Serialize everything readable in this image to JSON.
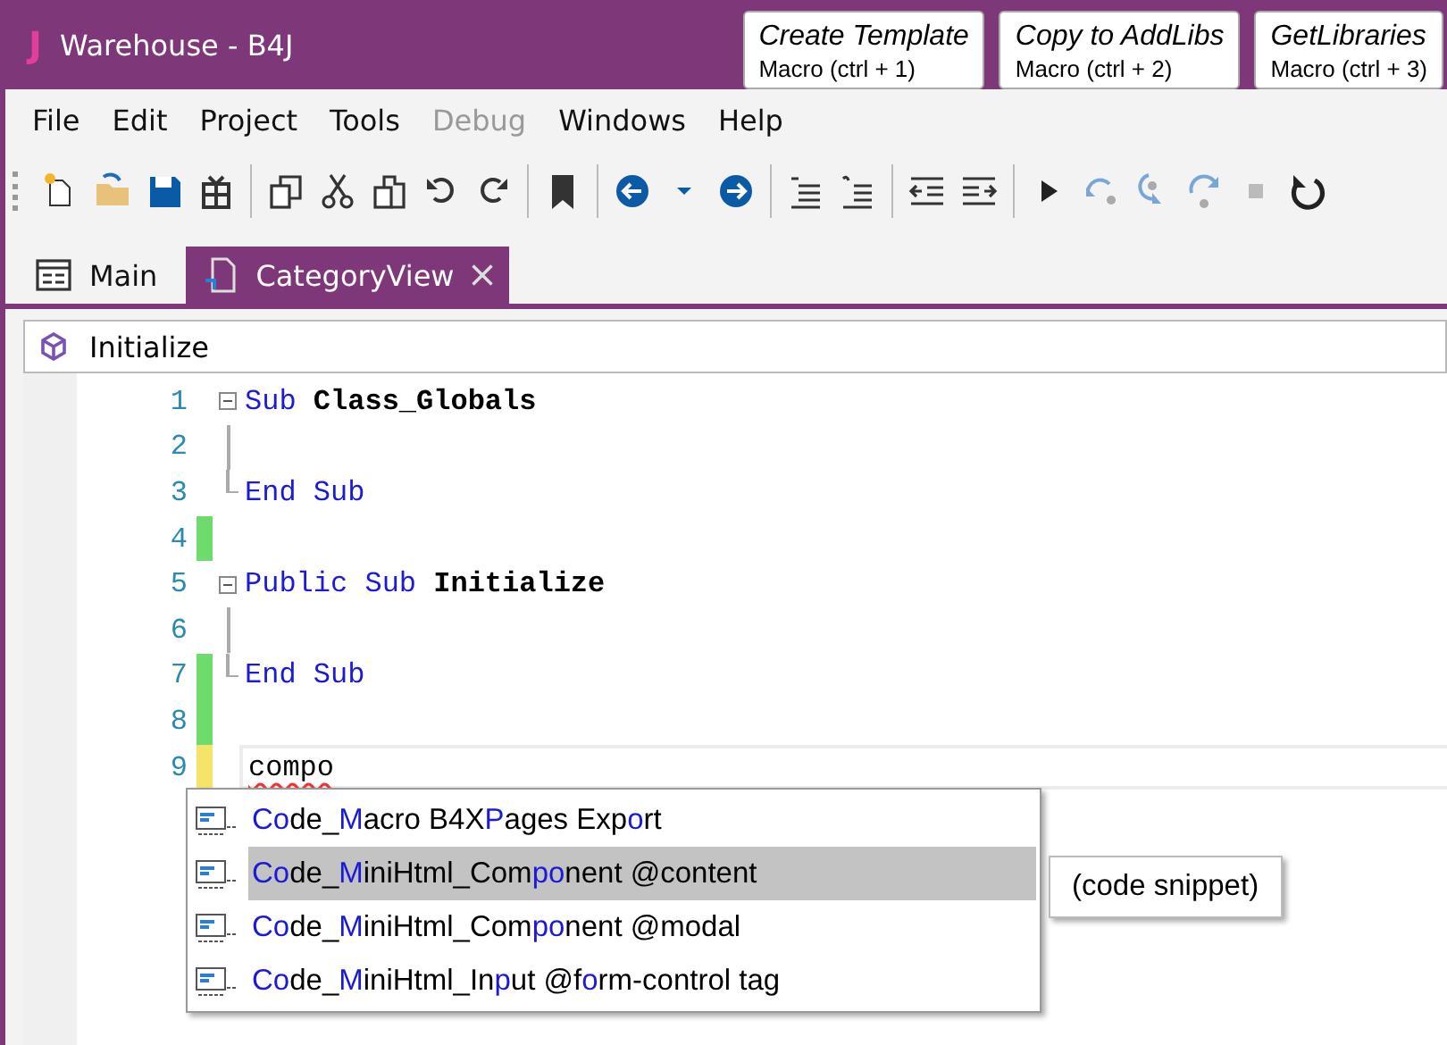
{
  "window": {
    "logo": "J",
    "title": "Warehouse - B4J"
  },
  "macros": [
    {
      "title": "Create Template",
      "subtitle": "Macro  (ctrl + 1)"
    },
    {
      "title": "Copy to AddLibs",
      "subtitle": "Macro  (ctrl + 2)"
    },
    {
      "title": "GetLibraries",
      "subtitle": "Macro  (ctrl + 3)"
    }
  ],
  "menu": [
    {
      "label": "File",
      "disabled": false
    },
    {
      "label": "Edit",
      "disabled": false
    },
    {
      "label": "Project",
      "disabled": false
    },
    {
      "label": "Tools",
      "disabled": false
    },
    {
      "label": "Debug",
      "disabled": true
    },
    {
      "label": "Windows",
      "disabled": false
    },
    {
      "label": "Help",
      "disabled": false
    }
  ],
  "tabs": [
    {
      "label": "Main",
      "selected": false,
      "closable": false
    },
    {
      "label": "CategoryView",
      "selected": true,
      "closable": true
    }
  ],
  "member_bar": {
    "label": "Initialize"
  },
  "editor": {
    "lines": [
      {
        "number": "1",
        "collapsible": true,
        "in_block": false,
        "current": false,
        "tokens": [
          {
            "kind": "keyword",
            "text": "Sub"
          },
          {
            "kind": "name",
            "text": "Class_Globals"
          }
        ]
      },
      {
        "number": "2",
        "collapsible": false,
        "in_block": true,
        "current": false
      },
      {
        "number": "3",
        "collapsible": false,
        "in_block": true,
        "current": false,
        "tokens": [
          {
            "kind": "keyword",
            "text": "End Sub"
          }
        ]
      },
      {
        "number": "4",
        "collapsible": false,
        "in_block": false,
        "current": false,
        "color": "#6ddc6d"
      },
      {
        "number": "5",
        "collapsible": true,
        "in_block": false,
        "current": false,
        "tokens": [
          {
            "kind": "keyword",
            "text": "Public Sub"
          },
          {
            "kind": "name",
            "text": "Initialize"
          }
        ]
      },
      {
        "number": "6",
        "collapsible": false,
        "in_block": true,
        "current": false
      },
      {
        "number": "7",
        "collapsible": false,
        "in_block": true,
        "current": false,
        "color": "#6ddc6d",
        "tokens": [
          {
            "kind": "keyword",
            "text": "End Sub"
          }
        ]
      },
      {
        "number": "8",
        "collapsible": false,
        "in_block": false,
        "current": false,
        "color": "#6ddc6d"
      },
      {
        "number": "9",
        "collapsible": false,
        "in_block": false,
        "current": true,
        "color": "#f5e36a",
        "tokens": [
          {
            "kind": "error",
            "text": "compo"
          }
        ]
      }
    ]
  },
  "autocomplete": {
    "items": [
      {
        "selected": false,
        "parts": [
          {
            "text": "Co",
            "match": true
          },
          {
            "text": "de_",
            "match": false
          },
          {
            "text": "M",
            "match": true
          },
          {
            "text": "acro B4X",
            "match": false
          },
          {
            "text": "P",
            "match": true
          },
          {
            "text": "ages Exp",
            "match": false
          },
          {
            "text": "o",
            "match": true
          },
          {
            "text": "rt",
            "match": false
          }
        ]
      },
      {
        "selected": true,
        "parts": [
          {
            "text": "Co",
            "match": true
          },
          {
            "text": "de_",
            "match": false
          },
          {
            "text": "M",
            "match": true
          },
          {
            "text": "iniHtml_Com",
            "match": false
          },
          {
            "text": "po",
            "match": true
          },
          {
            "text": "nent @content",
            "match": false
          }
        ]
      },
      {
        "selected": false,
        "parts": [
          {
            "text": "Co",
            "match": true
          },
          {
            "text": "de_",
            "match": false
          },
          {
            "text": "M",
            "match": true
          },
          {
            "text": "iniHtml_Com",
            "match": false
          },
          {
            "text": "po",
            "match": true
          },
          {
            "text": "nent @modal",
            "match": false
          }
        ]
      },
      {
        "selected": false,
        "parts": [
          {
            "text": "Co",
            "match": true
          },
          {
            "text": "de_",
            "match": false
          },
          {
            "text": "M",
            "match": true
          },
          {
            "text": "iniHtml_In",
            "match": false
          },
          {
            "text": "p",
            "match": true
          },
          {
            "text": "ut @f",
            "match": false
          },
          {
            "text": "o",
            "match": true
          },
          {
            "text": "rm-control tag",
            "match": false
          }
        ]
      }
    ],
    "tooltip": "(code snippet)"
  }
}
